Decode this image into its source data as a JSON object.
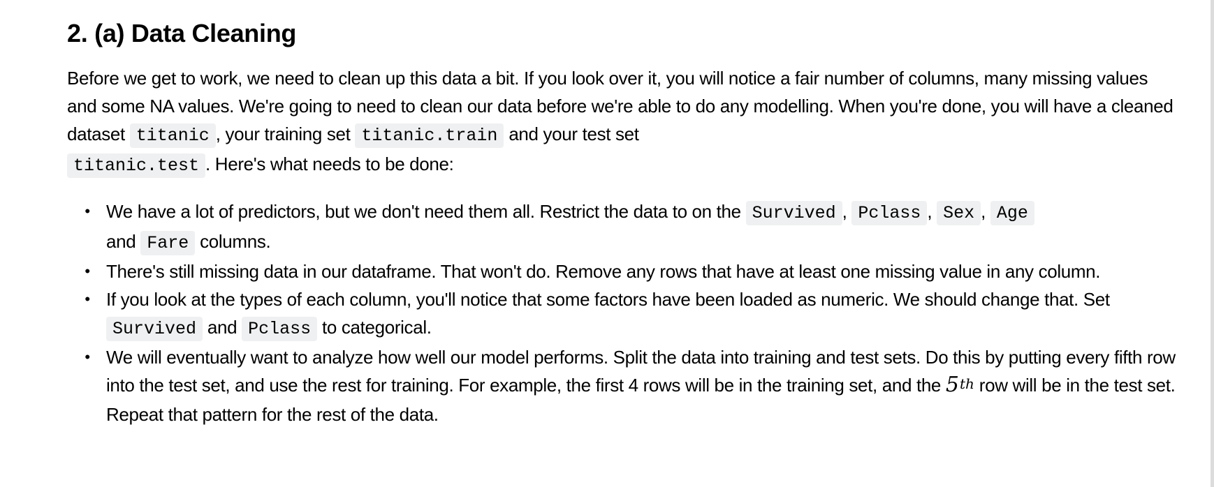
{
  "section": {
    "heading": "2. (a) Data Cleaning",
    "intro": {
      "t1": "Before we get to work, we need to clean up this data a bit. If you look over it, you will notice a fair number of columns, many missing values and some NA values. We're going to need to clean our data before we're able to do any modelling. When you're done, you will have a cleaned dataset ",
      "code1": "titanic",
      "t2": ", your training set ",
      "code2": "titanic.train",
      "t3": " and your test set ",
      "code3": "titanic.test",
      "t4": ". Here's what needs to be done:"
    },
    "bullet_glyph": "•",
    "tasks": [
      {
        "t1": "We have a lot of predictors, but we don't need them all. Restrict the data to on the ",
        "c1": "Survived",
        "t2": ", ",
        "c2": "Pclass",
        "t3": ", ",
        "c3": "Sex",
        "t4": ", ",
        "c4": "Age",
        "t5": " and ",
        "c5": "Fare",
        "t6": " columns."
      },
      {
        "t1": "There's still missing data in our dataframe. That won't do. Remove any rows that have at least one missing value in any column."
      },
      {
        "t1": "If you look at the types of each column, you'll notice that some factors have been loaded as numeric. We should change that. Set ",
        "c1": "Survived",
        "t2": " and ",
        "c2": "Pclass",
        "t3": " to categorical."
      },
      {
        "t1": "We will eventually want to analyze how well our model performs. Split the data into training and test sets. Do this by putting every fifth row into the test set, and use the rest for training. For example, the first 4 rows will be in the training set, and the ",
        "math_base": "5",
        "math_sup": "th",
        "t2": " row will be in the test set. Repeat that pattern for the rest of the data."
      }
    ]
  }
}
